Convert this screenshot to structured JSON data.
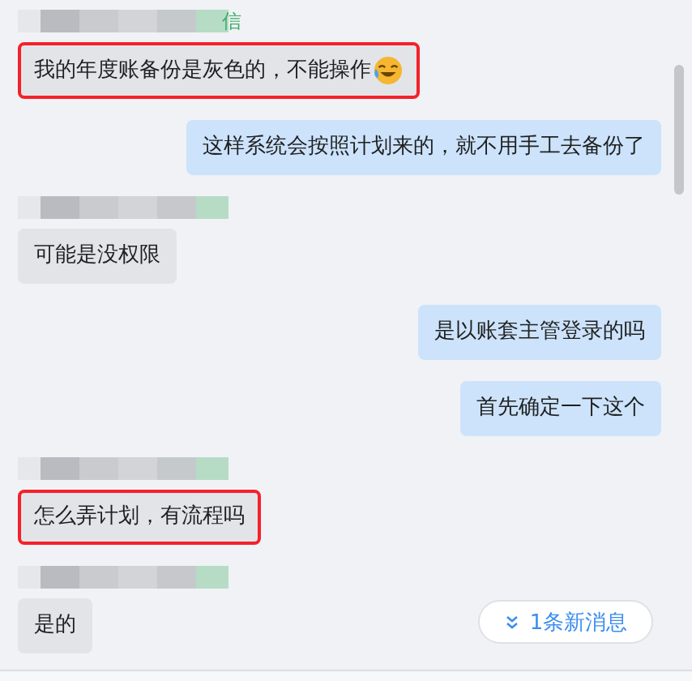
{
  "messages": [
    {
      "kind": "received",
      "name_blurred": true,
      "sender": "信",
      "text": "我的年度账备份是灰色的，不能操作",
      "emoji": true,
      "highlighted": true
    },
    {
      "kind": "sent",
      "text": "这样系统会按照计划来的，就不用手工去备份了",
      "highlighted": false
    },
    {
      "kind": "received",
      "name_blurred": true,
      "text": "可能是没权限",
      "highlighted": false
    },
    {
      "kind": "sent",
      "text": "是以账套主管登录的吗",
      "highlighted": false
    },
    {
      "kind": "sent",
      "text": "首先确定一下这个",
      "highlighted": false
    },
    {
      "kind": "received",
      "name_blurred": true,
      "text": "怎么弄计划，有流程吗",
      "highlighted": true
    },
    {
      "kind": "received",
      "name_blurred": true,
      "text": "是的",
      "highlighted": false
    }
  ],
  "new_messages": {
    "label": "1条新消息"
  }
}
